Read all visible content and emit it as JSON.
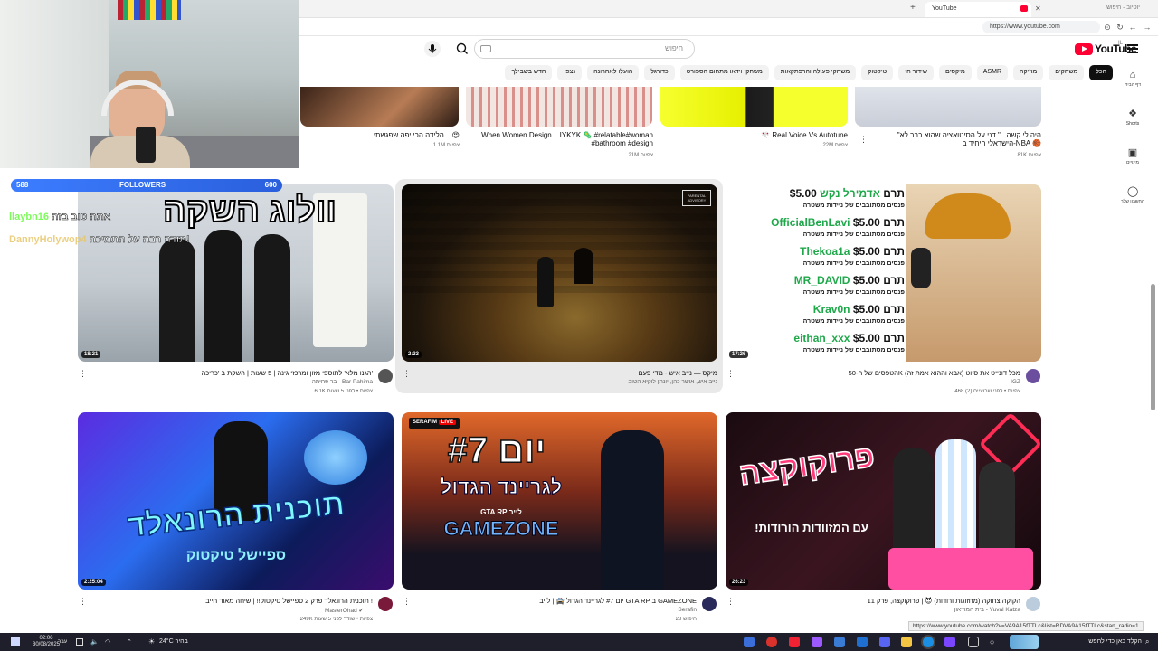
{
  "browser": {
    "tab_title": "YouTube",
    "inactive_tab": "יוטיוב - חיפוש",
    "url": "https://www.youtube.com",
    "status_url": "https://www.youtube.com/watch?v=VA9A15fTTLc&list=RDVA9A15fTTLc&start_radio=1"
  },
  "header": {
    "logo_text": "YouTube",
    "search_placeholder": "חיפוש"
  },
  "chips": [
    "הכל",
    "משחקים",
    "מוזיקה",
    "ASMR",
    "מיקסים",
    "שידור חי",
    "טיקטוק",
    "משחקי פעולה והרפתקאות",
    "משחקי וידאו מתחום הספורט",
    "כדורגל",
    "הועלו לאחרונה",
    "נצפו",
    "חדש בשבילך"
  ],
  "sidebar": [
    {
      "label": "דף הבית",
      "icon": "home-icon",
      "glyph": "⌂"
    },
    {
      "label": "Shorts",
      "icon": "shorts-icon",
      "glyph": "❖"
    },
    {
      "label": "מינויים",
      "icon": "subscriptions-icon",
      "glyph": "▣"
    },
    {
      "label": "החשבון שלך",
      "icon": "account-icon",
      "glyph": "◯"
    }
  ],
  "top_row": [
    {
      "title": "הלידה הכי יפה שפגשתי... 😍",
      "meta": "1.1M צפיות"
    },
    {
      "title": "When Women Design... IYKYK 🦠 #relatable#woman #bathroom #design",
      "meta": "21M צפיות"
    },
    {
      "title": "🎌 Real Voice Vs Autotune",
      "meta": "22M צפיות"
    },
    {
      "title": "\"היה לי קשה...\" דני על הסיטואציה שהוא כבר לא הישראלי היחיד ב-NBA 🏀",
      "meta": "81K צפיות"
    }
  ],
  "overlay": {
    "followers_label": "FOLLOWERS",
    "followers_current": "588",
    "followers_goal": "600",
    "chat_line1_user": "llaybn16",
    "chat_line1_text": "אתה טוב בזה",
    "chat_line2_user": "DannyHolywop4",
    "chat_line2_text": "תודה רבה על התמיכה!"
  },
  "videos": [
    {
      "title": "הגנו מלא' לתוספי מזון ומרכזי גינה | 5 שעות | השקת ב 'כריכה'",
      "channel": "בר פחימה - Bar Pahima",
      "meta": "6.1K צפיות • לפני 5 שעות",
      "duration": "18:21",
      "thumb_text": "וולוג השקה"
    },
    {
      "title": "מיקס — נייב איש - מדי פעם",
      "channel": "נייב איש, אושר כהן, יונתן לוקיא הטוב",
      "meta": "",
      "duration": "2:33",
      "thumb_text": ""
    },
    {
      "title": "הטפסים של ה-50K מכל דונייט את סיוט (אבא וההוא אמת זה)",
      "channel": "IGZ",
      "meta": "468 צפיות • לפני שבועיים (2)",
      "duration": "17:26",
      "thumb_text": ""
    },
    {
      "title": "תוכנית הרונאלד פרק 2 ספיישל טיקטוק!! | שיחה מאוד חייב !",
      "channel": "MasterOhad ✔",
      "meta": "249K צפיות • שודר לפני 5 שעות",
      "duration": "2:25:04",
      "thumb_text": "תוכנית הרונאלד"
    },
    {
      "title": "יום #7 לגריינד הגדול 🚔 | לייב GTA RP ב GAMEZONE",
      "channel": "Serafin",
      "meta": "28 חיפוש",
      "duration": "",
      "thumb_text": "יום #7"
    },
    {
      "title": "הקוקה צחוקה (מחזוגות ורודות) 😈 | פרוקוקצה, פרק 11",
      "channel": "בית המוזיאון - Yuval Katza",
      "meta": "",
      "duration": "26:23",
      "thumb_text": "פרוקוקצה"
    }
  ],
  "donations": [
    {
      "name": "אדמירל נקש",
      "amount": "$5.00"
    },
    {
      "name": "OfficialBenLavi",
      "amount": "$5.00"
    },
    {
      "name": "Thekoa1a",
      "amount": "$5.00"
    },
    {
      "name": "MR_DAVID",
      "amount": "$5.00"
    },
    {
      "name": "Krav0n",
      "amount": "$5.00"
    },
    {
      "name": "eithan_xxx",
      "amount": "$5.00"
    }
  ],
  "donation_word": "תרם",
  "donation_sub": "פנסים מסתובבים של ניידות משטרה",
  "thumb_labels": {
    "gta_sub": "לגריינד הגדול",
    "gta_brand": "GAMEZONE",
    "gta_pre": "GTA RP לייב",
    "live_badge": "LIVE",
    "live_channel": "SERAFIM",
    "ronald_sub": "ספיישל טיקטוק",
    "proko_sub": "עם המזוודות הורודות!",
    "advisory": "PARENTAL ADVISORY"
  },
  "taskbar": {
    "time": "02:06",
    "date": "30/08/2025",
    "weather": "24°C בהיר",
    "lang": "עבר",
    "search_text": "הקלד כאן כדי לחפש"
  }
}
